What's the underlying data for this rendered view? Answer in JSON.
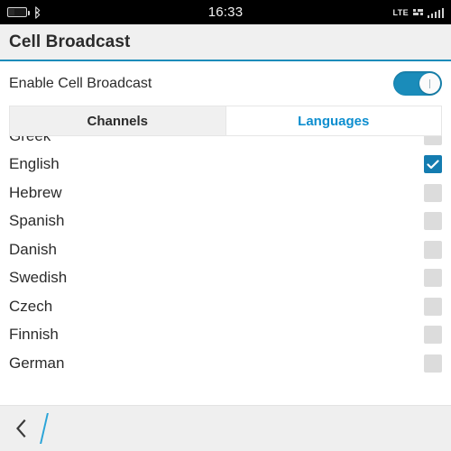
{
  "statusbar": {
    "battery_icon": "battery-icon",
    "bluetooth_icon": "bluetooth-icon",
    "time": "16:33",
    "network_type": "LTE",
    "data_icon": "data-transfer-icon",
    "signal_icon": "signal-bars-icon"
  },
  "header": {
    "title": "Cell Broadcast",
    "accent_color": "#1a8cba"
  },
  "enable": {
    "label": "Enable Cell Broadcast",
    "toggle_state": "on",
    "toggle_color": "#1a8cba"
  },
  "tabs": [
    {
      "label": "Channels",
      "active": false
    },
    {
      "label": "Languages",
      "active": true
    }
  ],
  "languages": [
    {
      "name": "Greek",
      "checked": false
    },
    {
      "name": "English",
      "checked": true
    },
    {
      "name": "Hebrew",
      "checked": false
    },
    {
      "name": "Spanish",
      "checked": false
    },
    {
      "name": "Danish",
      "checked": false
    },
    {
      "name": "Swedish",
      "checked": false
    },
    {
      "name": "Czech",
      "checked": false
    },
    {
      "name": "Finnish",
      "checked": false
    },
    {
      "name": "German",
      "checked": false
    }
  ],
  "checkbox_colors": {
    "unchecked": "#dcdcdc",
    "checked": "#147cb0"
  },
  "bottombar": {
    "back_icon": "back-chevron-icon",
    "divider_icon": "slash-divider-icon",
    "divider_color": "#2aa4d8"
  }
}
